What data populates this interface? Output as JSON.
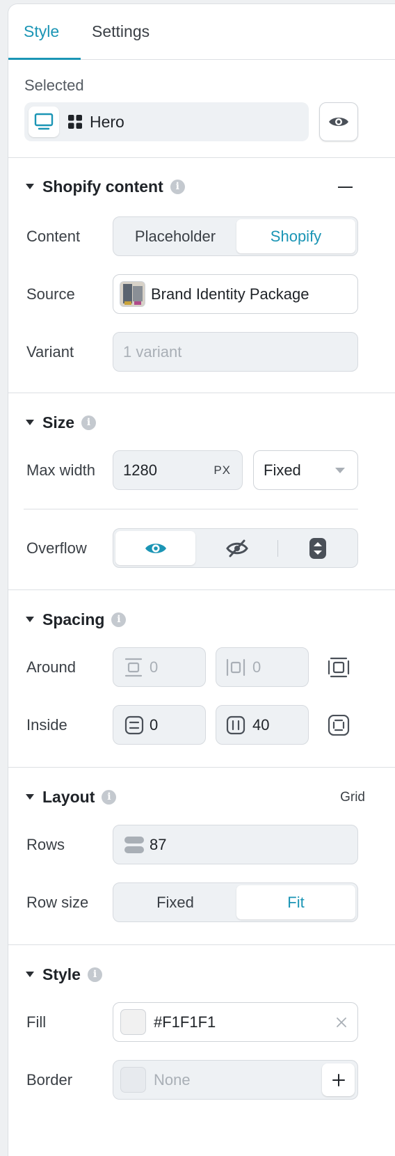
{
  "tabs": {
    "style": "Style",
    "settings": "Settings"
  },
  "selected": {
    "label": "Selected",
    "element_name": "Hero"
  },
  "shopify_content": {
    "title": "Shopify content",
    "content": {
      "label": "Content",
      "options": [
        "Placeholder",
        "Shopify"
      ],
      "selected": "Shopify"
    },
    "source": {
      "label": "Source",
      "value": "Brand Identity Package"
    },
    "variant": {
      "label": "Variant",
      "placeholder": "1 variant"
    }
  },
  "size": {
    "title": "Size",
    "max_width": {
      "label": "Max width",
      "value": "1280",
      "unit": "PX",
      "mode": "Fixed"
    },
    "overflow": {
      "label": "Overflow",
      "selected": "visible"
    }
  },
  "spacing": {
    "title": "Spacing",
    "around": {
      "label": "Around",
      "vertical": "0",
      "horizontal": "0"
    },
    "inside": {
      "label": "Inside",
      "vertical": "0",
      "horizontal": "40"
    }
  },
  "layout": {
    "title": "Layout",
    "type": "Grid",
    "rows": {
      "label": "Rows",
      "value": "87"
    },
    "row_size": {
      "label": "Row size",
      "options": [
        "Fixed",
        "Fit"
      ],
      "selected": "Fit"
    }
  },
  "style": {
    "title": "Style",
    "fill": {
      "label": "Fill",
      "value": "#F1F1F1",
      "swatch": "#F1F1F1"
    },
    "border": {
      "label": "Border",
      "value": "None"
    }
  },
  "colors": {
    "accent": "#1b95b5",
    "icon_dark": "#4a5058",
    "icon_muted": "#a9afb6"
  }
}
